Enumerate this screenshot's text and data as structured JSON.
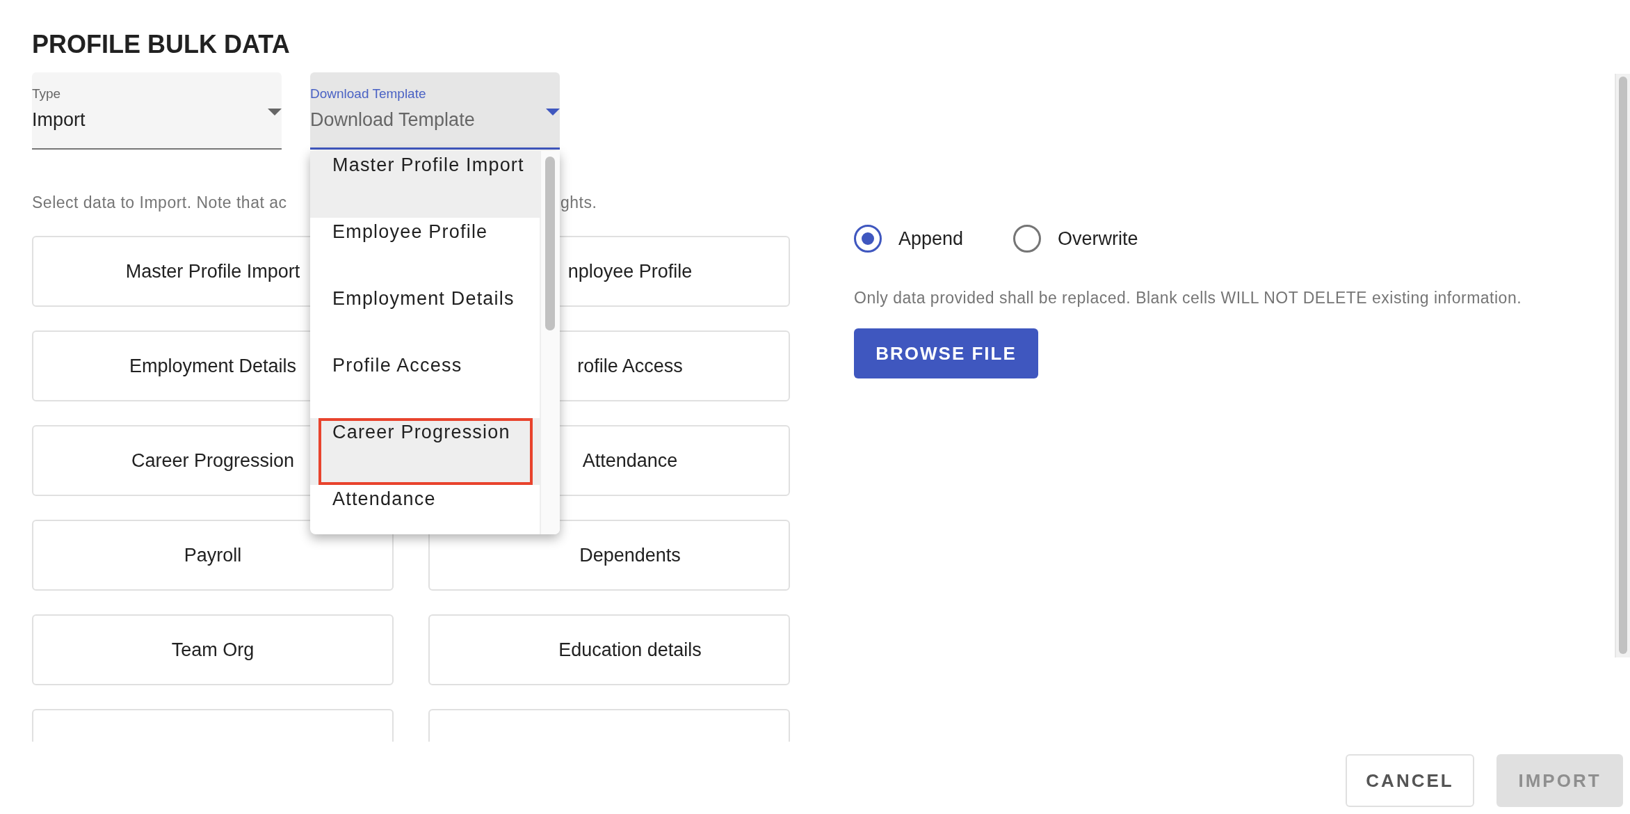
{
  "title": "PROFILE BULK DATA",
  "fields": [
    {
      "label": "Type",
      "value": "Import",
      "focused": false
    },
    {
      "label": "Download Template",
      "value": "Download Template",
      "focused": true
    }
  ],
  "dropdown_menu": {
    "items": [
      {
        "label": "Master Profile Import",
        "highlighted": true,
        "outlined": false
      },
      {
        "label": "Employee Profile",
        "highlighted": false,
        "outlined": false
      },
      {
        "label": "Employment Details",
        "highlighted": false,
        "outlined": false
      },
      {
        "label": "Profile Access",
        "highlighted": false,
        "outlined": false
      },
      {
        "label": "Career Progression",
        "highlighted": true,
        "outlined": true
      },
      {
        "label": "Attendance",
        "highlighted": false,
        "outlined": false
      }
    ]
  },
  "instruction_parts": [
    "Select data to Import. Note that ac",
    "ghts."
  ],
  "data_cards": [
    "Master Profile Import",
    "nployee Profile",
    "Employment Details",
    "rofile Access",
    "Career Progression",
    "Attendance",
    "Payroll",
    "Dependents",
    "Team Org",
    "Education details"
  ],
  "clipped_cards": [
    {
      "kind": "blank"
    },
    {
      "kind": "blank"
    }
  ],
  "mode_options": [
    {
      "label": "Append",
      "selected": true
    },
    {
      "label": "Overwrite",
      "selected": false
    }
  ],
  "mode_note": "Only data provided shall be replaced. Blank cells WILL NOT DELETE existing information.",
  "browse_button": "BROWSE FILE",
  "footer_buttons": [
    {
      "label": "CANCEL",
      "disabled": false
    },
    {
      "label": "IMPORT",
      "disabled": true
    }
  ]
}
